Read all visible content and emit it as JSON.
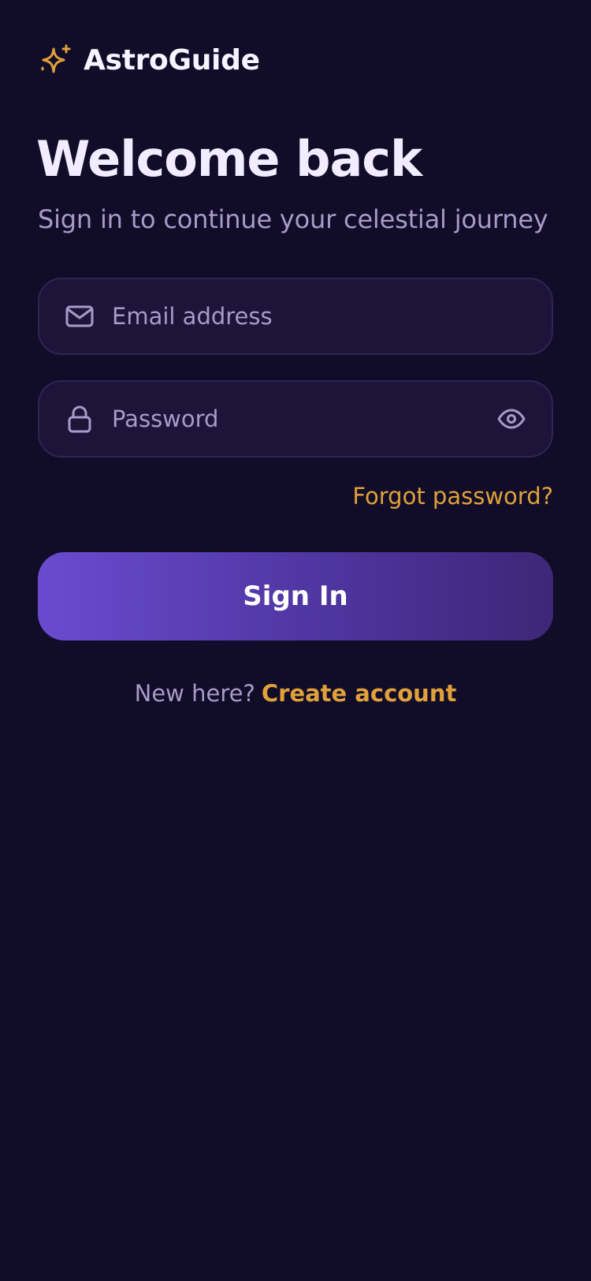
{
  "brand": {
    "name": "AstroGuide",
    "icon": "sparkle-icon",
    "accent_color": "#e0a13b"
  },
  "header": {
    "title": "Welcome back",
    "subtitle": "Sign in to continue your celestial journey"
  },
  "form": {
    "email": {
      "placeholder": "Email address",
      "value": "",
      "icon": "mail-icon"
    },
    "password": {
      "placeholder": "Password",
      "value": "",
      "icon": "lock-icon",
      "toggle_icon": "eye-icon"
    },
    "forgot_label": "Forgot password?",
    "submit_label": "Sign In"
  },
  "footer": {
    "prompt": "New here?",
    "link_label": "Create account"
  },
  "colors": {
    "background": "#110c28",
    "field_background": "#1c1539",
    "field_border": "#2e2552",
    "muted_text": "#a79bc9",
    "primary_gradient_start": "#6a4bd0",
    "primary_gradient_end": "#3e2677"
  }
}
